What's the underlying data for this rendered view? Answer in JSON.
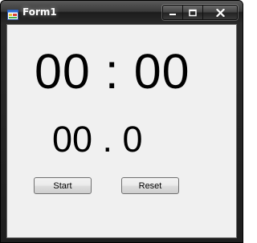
{
  "window": {
    "title": "Form1"
  },
  "caption_buttons": {
    "minimize_icon": "minimize-icon",
    "maximize_icon": "maximize-icon",
    "close_icon": "close-icon"
  },
  "display": {
    "minutes_seconds": "00 : 00",
    "tenths": "00 . 0"
  },
  "buttons": {
    "start_label": "Start",
    "reset_label": "Reset"
  },
  "colors": {
    "client_background": "#f0f0f0",
    "titlebar": "#2a2a2a",
    "text": "#000000"
  }
}
